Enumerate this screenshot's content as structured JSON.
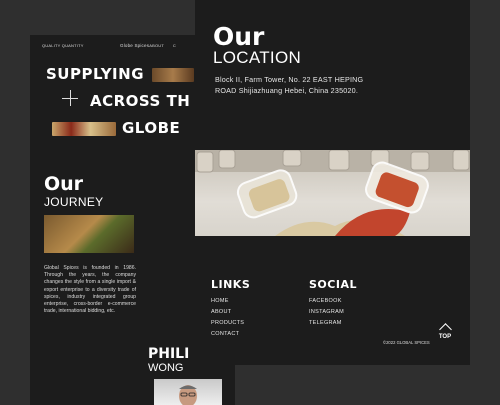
{
  "left_page": {
    "nav": {
      "quality": "QUALITY QUANTITY",
      "brand": "Globe Spices",
      "about": "ABOUT",
      "contact": "C"
    },
    "hero": {
      "line1": "SUPPLYING",
      "line2": "ACROSS TH",
      "line3": "GLOBE"
    },
    "journey": {
      "title": "Our",
      "subtitle": "JOURNEY",
      "text": "Global Spices is founded in 1986. Through the years, the company changes the style from a single import & export enterprise to a diversity trade of spices, industry integrated group enterprise, cross-border e-commerce trade, international bidding, etc."
    }
  },
  "person": {
    "first": "PHILI",
    "last": "WONG"
  },
  "right_page": {
    "location": {
      "title": "Our",
      "subtitle": "LOCATION",
      "address": "Block II, Farm Tower, No. 22 EAST HEPING ROAD Shijiazhuang Hebei, China 235020."
    },
    "links": {
      "heading": "LINKS",
      "items": [
        "HOME",
        "ABOUT",
        "PRODUCTS",
        "CONTACT"
      ]
    },
    "social": {
      "heading": "SOCIAL",
      "items": [
        "FACEBOOK",
        "INSTAGRAM",
        "TELEGRAM"
      ]
    },
    "copyright": "©2022 GLOBAL SPICES",
    "top_label": "TOP"
  },
  "colors": {
    "page_bg": "#1c1c1c",
    "backdrop": "#2f2f2f",
    "spice_red": "#c2452d"
  }
}
